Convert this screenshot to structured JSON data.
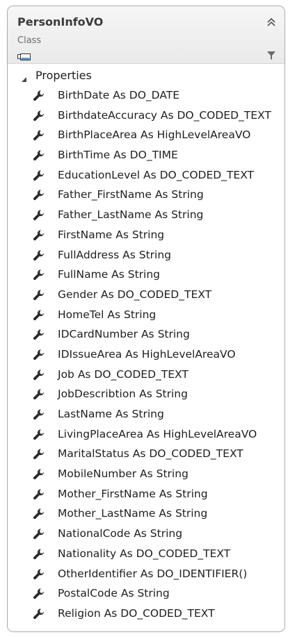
{
  "header": {
    "class_name": "PersonInfoVO",
    "class_kind": "Class"
  },
  "section": {
    "label": "Properties"
  },
  "properties": [
    "BirthDate As DO_DATE",
    "BirthdateAccuracy As DO_CODED_TEXT",
    "BirthPlaceArea As HighLevelAreaVO",
    "BirthTime As DO_TIME",
    "EducationLevel As DO_CODED_TEXT",
    "Father_FirstName As String",
    "Father_LastName As String",
    "FirstName As String",
    "FullAddress As String",
    "FullName As String",
    "Gender As DO_CODED_TEXT",
    "HomeTel As String",
    "IDCardNumber As String",
    "IDIssueArea As HighLevelAreaVO",
    "Job As DO_CODED_TEXT",
    "JobDescribtion As String",
    "LastName As String",
    "LivingPlaceArea As HighLevelAreaVO",
    "MaritalStatus As DO_CODED_TEXT",
    "MobileNumber As String",
    "Mother_FirstName As String",
    "Mother_LastName As String",
    "NationalCode As String",
    "Nationality As DO_CODED_TEXT",
    "OtherIdentifier As DO_IDENTIFIER()",
    "PostalCode As String",
    "Religion As DO_CODED_TEXT"
  ],
  "icons": {
    "collapse": "double-chevron-up-icon",
    "class": "class-shape-icon",
    "filter": "filter-icon",
    "section_toggle": "triangle-expanded-icon",
    "property": "wrench-icon"
  }
}
